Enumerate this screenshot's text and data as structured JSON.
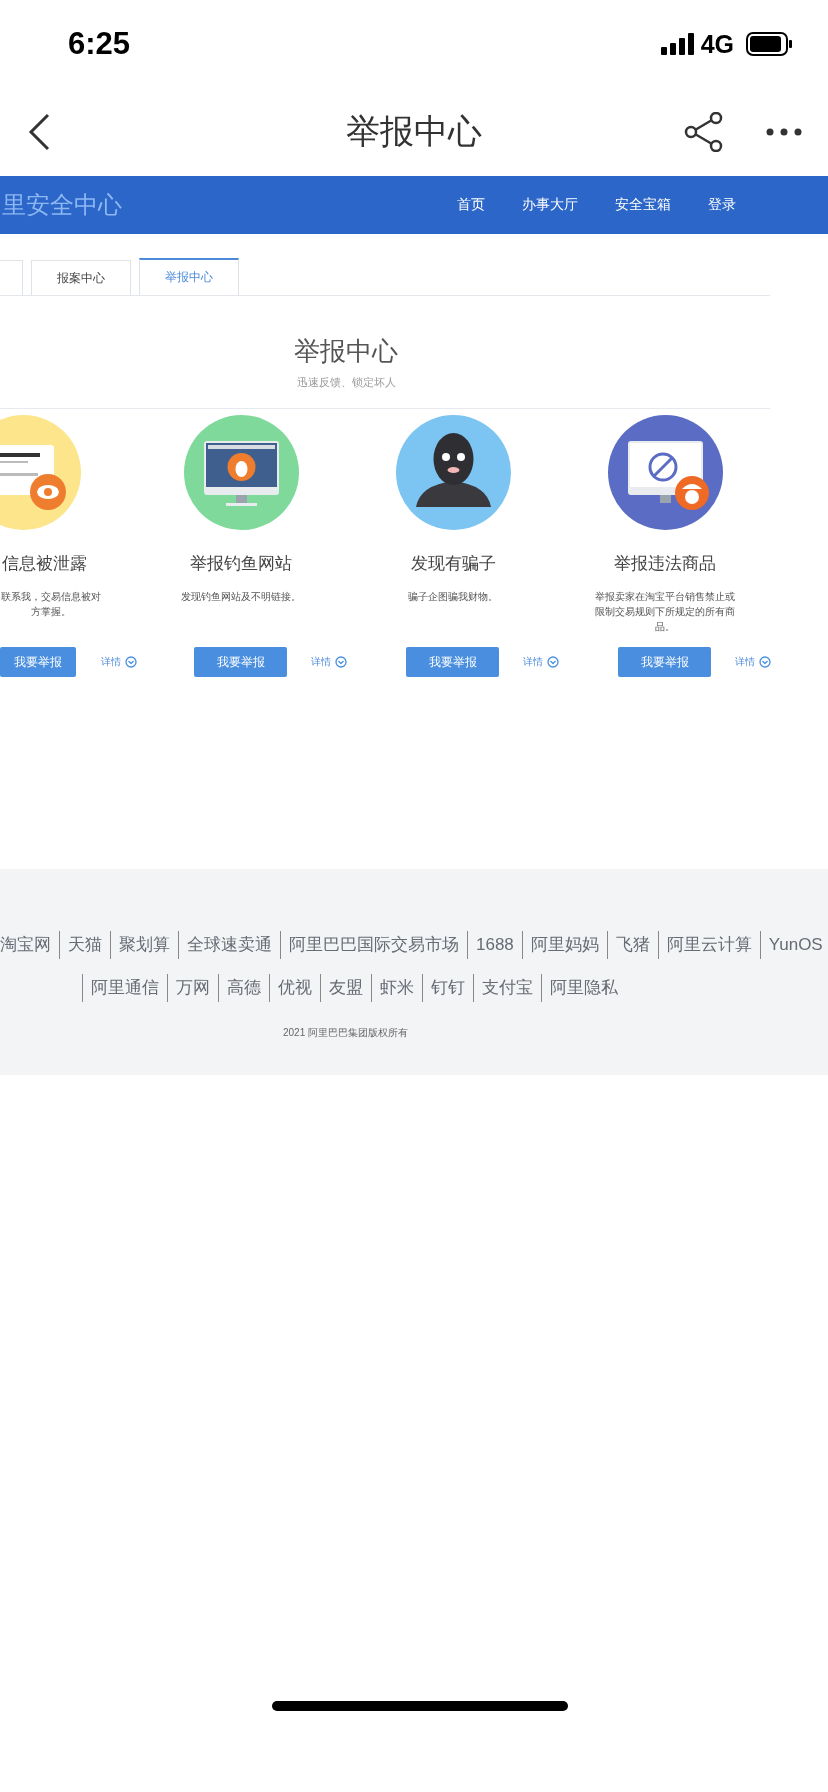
{
  "status_bar": {
    "time": "6:25",
    "network": "4G"
  },
  "nav": {
    "title": "举报中心"
  },
  "site_header": {
    "logo": "里安全中心",
    "menu": [
      {
        "label": "首页"
      },
      {
        "label": "办事大厅"
      },
      {
        "label": "安全宝箱"
      },
      {
        "label": "登录"
      }
    ]
  },
  "tabs": [
    {
      "label": "报案中心",
      "selected": false
    },
    {
      "label": "举报中心",
      "selected": true
    }
  ],
  "section": {
    "title": "举报中心",
    "subtitle": "迅速反馈、锁定坏人"
  },
  "cards": [
    {
      "title": "信息被泄露",
      "description": "联系我，交易信息被对方掌握。",
      "button": "我要举报",
      "details": "详情"
    },
    {
      "title": "举报钓鱼网站",
      "description": "发现钓鱼网站及不明链接。",
      "button": "我要举报",
      "details": "详情"
    },
    {
      "title": "发现有骗子",
      "description": "骗子企图骗我财物。",
      "button": "我要举报",
      "details": "详情"
    },
    {
      "title": "举报违法商品",
      "description": "举报卖家在淘宝平台销售禁止或限制交易规则下所规定的所有商品。",
      "button": "我要举报",
      "details": "详情"
    }
  ],
  "footer": {
    "links_row_1": [
      "淘宝网",
      "天猫",
      "聚划算",
      "全球速卖通",
      "阿里巴巴国际交易市场",
      "1688",
      "阿里妈妈",
      "飞猪",
      "阿里云计算",
      "YunOS"
    ],
    "links_row_2": [
      "阿里通信",
      "万网",
      "高德",
      "优视",
      "友盟",
      "虾米",
      "钉钉",
      "支付宝",
      "阿里隐私"
    ],
    "copyright": "2021 阿里巴巴集团版权所有"
  }
}
